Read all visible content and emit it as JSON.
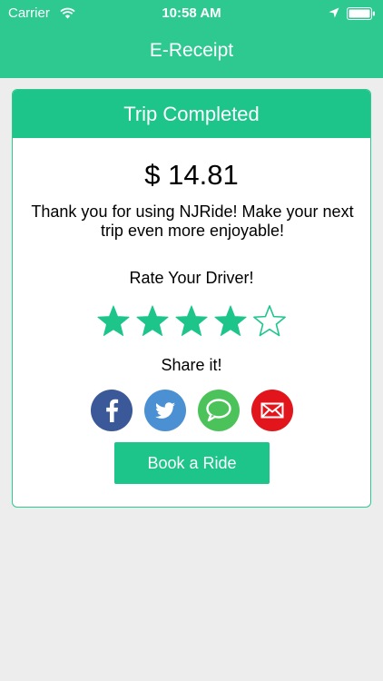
{
  "status_bar": {
    "carrier": "Carrier",
    "time": "10:58 AM"
  },
  "nav": {
    "title": "E-Receipt"
  },
  "receipt": {
    "header": "Trip Completed",
    "amount": "$ 14.81",
    "message": "Thank you for using NJRide! Make your next trip even more enjoyable!",
    "rate_label": "Rate Your Driver!",
    "rating": 4,
    "rating_max": 5,
    "share_label": "Share it!",
    "share_options": [
      "facebook-icon",
      "twitter-icon",
      "message-icon",
      "email-icon"
    ],
    "book_button": "Book a Ride"
  },
  "colors": {
    "brand": "#2ec990",
    "accent": "#1dc58b",
    "facebook": "#3b5998",
    "twitter": "#4a90d2",
    "message": "#4cc35a",
    "email": "#e3151c"
  }
}
